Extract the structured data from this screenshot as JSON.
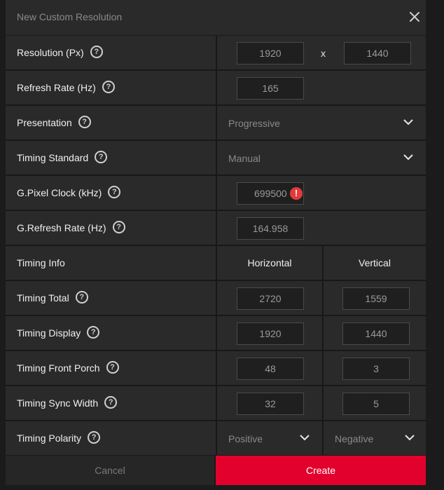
{
  "dialog": {
    "title": "New Custom Resolution",
    "close_icon": "close-icon"
  },
  "help_glyph": "?",
  "rows": {
    "resolution": {
      "label": "Resolution (Px)",
      "width": "1920",
      "separator": "x",
      "height": "1440"
    },
    "refresh_rate": {
      "label": "Refresh Rate (Hz)",
      "value": "165"
    },
    "presentation": {
      "label": "Presentation",
      "selected": "Progressive"
    },
    "timing_standard": {
      "label": "Timing Standard",
      "selected": "Manual"
    },
    "pixel_clock": {
      "label": "G.Pixel Clock (kHz)",
      "value": "699500",
      "error_glyph": "!"
    },
    "g_refresh_rate": {
      "label": "G.Refresh Rate (Hz)",
      "value": "164.958"
    },
    "timing_info": {
      "label": "Timing Info",
      "horizontal": "Horizontal",
      "vertical": "Vertical"
    },
    "timing_total": {
      "label": "Timing Total",
      "horizontal": "2720",
      "vertical": "1559"
    },
    "timing_display": {
      "label": "Timing Display",
      "horizontal": "1920",
      "vertical": "1440"
    },
    "timing_front_porch": {
      "label": "Timing Front Porch",
      "horizontal": "48",
      "vertical": "3"
    },
    "timing_sync_width": {
      "label": "Timing Sync Width",
      "horizontal": "32",
      "vertical": "5"
    },
    "timing_polarity": {
      "label": "Timing Polarity",
      "horizontal": "Positive",
      "vertical": "Negative"
    }
  },
  "buttons": {
    "cancel": "Cancel",
    "create": "Create"
  },
  "colors": {
    "accent": "#e2012d",
    "error": "#e23b3b"
  }
}
